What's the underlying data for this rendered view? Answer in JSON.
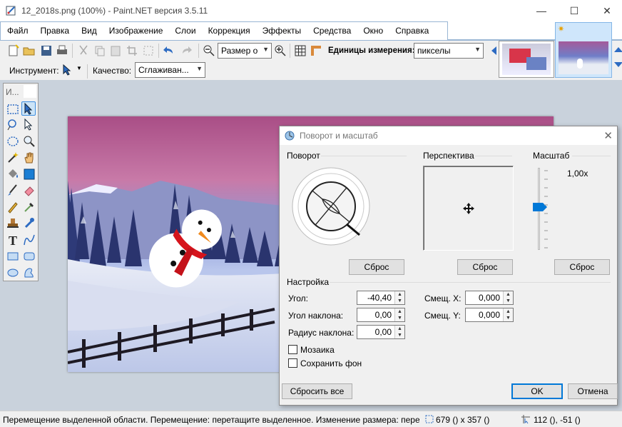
{
  "window": {
    "title": "12_2018s.png (100%) - Paint.NET версия 3.5.11",
    "min_glyph": "—",
    "max_glyph": "☐",
    "close_glyph": "✕"
  },
  "menu": [
    "Файл",
    "Правка",
    "Вид",
    "Изображение",
    "Слои",
    "Коррекция",
    "Эффекты",
    "Средства",
    "Окно",
    "Справка"
  ],
  "toolbar": {
    "zoom_label": "Размер о",
    "units_label": "Единицы измерения:",
    "units_value": "пикселы",
    "tool_label": "Инструмент:",
    "quality_label": "Качество:",
    "quality_value": "Сглаживан..."
  },
  "toolbox": {
    "header": "И..."
  },
  "dialog": {
    "title": "Поворот и масштаб",
    "rotation_header": "Поворот",
    "perspective_header": "Перспектива",
    "scale_header": "Масштаб",
    "scale_value": "1,00x",
    "reset_label": "Сброс",
    "settings_header": "Настройка",
    "angle_label": "Угол:",
    "angle_value": "-40,40",
    "tilt_label": "Угол наклона:",
    "tilt_value": "0,00",
    "radius_label": "Радиус наклона:",
    "radius_value": "0,00",
    "offset_x_label": "Смещ. X:",
    "offset_x_value": "0,000",
    "offset_y_label": "Смещ. Y:",
    "offset_y_value": "0,000",
    "tile_label": "Мозаика",
    "keep_bg_label": "Сохранить фон",
    "reset_all_label": "Сбросить все",
    "ok_label": "OK",
    "cancel_label": "Отмена"
  },
  "status": {
    "message": "Перемещение выделенной области. Перемещение: перетащите выделенное. Изменение размера: перета",
    "selection_size": "679 () x 357 ()",
    "cursor_pos": "112 (), -51 ()"
  },
  "colors": {
    "accent": "#0078d7",
    "menu_border": "#99b6d4",
    "workspace": "#c9d2dc"
  }
}
